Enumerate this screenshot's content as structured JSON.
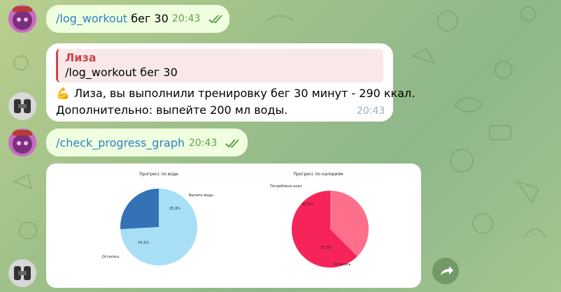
{
  "messages": [
    {
      "command": "/log_workout",
      "args": " бег 30",
      "time": "20:43"
    },
    {
      "reply_to": {
        "name": "Лиза",
        "text": "/log_workout бег 30"
      },
      "line1": "Лиза, вы выполнили тренировку бег 30 минут - 290 ккал.",
      "line2": "Дополнительно: выпейте 200 мл воды.",
      "emoji": "💪",
      "time": "20:43"
    },
    {
      "command": "/check_progress_graph",
      "time": "20:43"
    }
  ],
  "charts_image": {
    "chart_data": [
      {
        "type": "pie",
        "title": "Прогресс по воде",
        "slices": [
          {
            "label": "Выпито воды",
            "value": 25.9,
            "pct_text": "25.9%",
            "color": "#3272b5"
          },
          {
            "label": "Осталось",
            "value": 74.1,
            "pct_text": "74.1%",
            "color": "#a8dff7"
          }
        ]
      },
      {
        "type": "pie",
        "title": "Прогресс по калориям",
        "slices": [
          {
            "label": "Потреблено ккал",
            "value": 62.5,
            "pct_text": "62.5%",
            "color": "#f7245a"
          },
          {
            "label": "Осталось",
            "value": 37.5,
            "pct_text": "37.5%",
            "color": "#fd6f8a"
          }
        ]
      }
    ]
  },
  "colors": {
    "outgoing_bubble": "#eefedf",
    "incoming_bubble": "#ffffff",
    "command_link": "#2f81c5",
    "reply_accent": "#d1444c"
  },
  "icons": {
    "read_ticks": "double-check-icon",
    "share": "share-arrow-icon"
  }
}
